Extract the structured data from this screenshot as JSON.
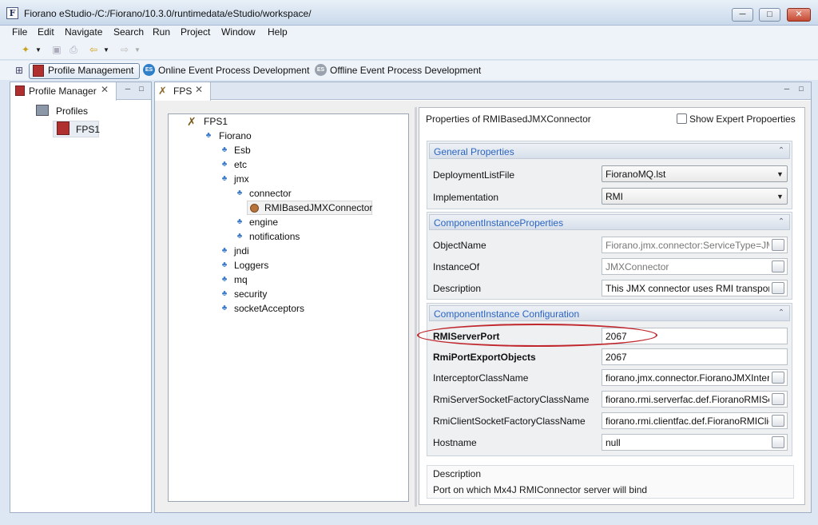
{
  "window": {
    "title": "Fiorano eStudio-/C:/Fiorano/10.3.0/runtimedata/eStudio/workspace/",
    "min_glyph": "─",
    "max_glyph": "□",
    "close_glyph": "✕"
  },
  "menu": [
    "File",
    "Edit",
    "Navigate",
    "Search",
    "Run",
    "Project",
    "Window",
    "Help"
  ],
  "perspectives": {
    "profile_management": "Profile Management",
    "online": "Online Event Process Development",
    "offline": "Offline Event Process Development",
    "badge_text": "ES"
  },
  "left_view": {
    "tab_label": "Profile Manager",
    "tree": {
      "root": "Profiles",
      "child": "FPS1"
    }
  },
  "editor": {
    "tab_label": "FPS",
    "tree": {
      "root": "FPS1",
      "fiorano": "Fiorano",
      "nodes": [
        "Esb",
        "etc",
        "jmx",
        "connector",
        "RMIBasedJMXConnector",
        "engine",
        "notifications",
        "jndi",
        "Loggers",
        "mq",
        "security",
        "socketAcceptors"
      ]
    },
    "properties": {
      "heading": "Properties of RMIBasedJMXConnector",
      "show_expert_label": "Show Expert Propoerties",
      "sections": {
        "general": {
          "title": "General Properties",
          "deployment_list_label": "DeploymentListFile",
          "deployment_list_value": "FioranoMQ.lst",
          "implementation_label": "Implementation",
          "implementation_value": "RMI"
        },
        "instance_props": {
          "title": "ComponentInstanceProperties",
          "object_name_label": "ObjectName",
          "object_name_value": "Fiorano.jmx.connector:ServiceType=JMXCo",
          "instance_of_label": "InstanceOf",
          "instance_of_value": "JMXConnector",
          "description_label": "Description",
          "description_value": "This JMX connector uses RMI transport"
        },
        "instance_config": {
          "title": "ComponentInstance Configuration",
          "rmi_server_port_label": "RMIServerPort",
          "rmi_server_port_value": "2067",
          "rmi_port_export_label": "RmiPortExportObjects",
          "rmi_port_export_value": "2067",
          "interceptor_label": "InterceptorClassName",
          "interceptor_value": "fiorano.jmx.connector.FioranoJMXInterceptor",
          "server_socket_label": "RmiServerSocketFactoryClassName",
          "server_socket_value": "fiorano.rmi.serverfac.def.FioranoRMIServerSocketFactory",
          "client_socket_label": "RmiClientSocketFactoryClassName",
          "client_socket_value": "fiorano.rmi.clientfac.def.FioranoRMIClientSocketFactory",
          "hostname_label": "Hostname",
          "hostname_value": "null"
        }
      },
      "description": {
        "title": "Description",
        "text": "Port on which Mx4J RMIConnector server will bind"
      }
    }
  },
  "colors": {
    "section_title": "#2b65c2",
    "highlight_oval": "#c0272d",
    "tree_icon": "#3d7ac6"
  }
}
